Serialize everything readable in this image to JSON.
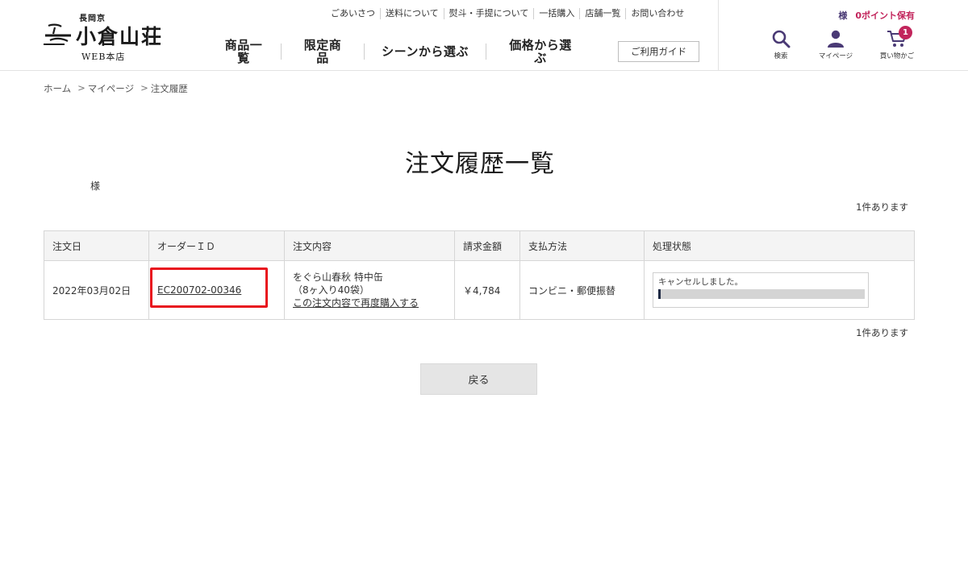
{
  "header": {
    "logo": {
      "sub": "長岡京",
      "main": "小倉山荘",
      "web": "WEB本店"
    },
    "top_nav": [
      "ごあいさつ",
      "送料について",
      "熨斗・手提について",
      "一括購入",
      "店舗一覧",
      "お問い合わせ"
    ],
    "main_nav": [
      "商品一覧",
      "限定商品",
      "シーンから選ぶ",
      "価格から選ぶ"
    ],
    "guide_label": "ご利用ガイド",
    "user_suffix": "様",
    "points_label": "0ポイント保有",
    "icons": {
      "search": {
        "label": "検索",
        "icon": "search-icon"
      },
      "mypage": {
        "label": "マイページ",
        "icon": "user-icon"
      },
      "cart": {
        "label": "買い物かご",
        "icon": "cart-icon",
        "badge": "1"
      }
    }
  },
  "breadcrumb": {
    "home": "ホーム",
    "mypage": "マイページ",
    "current": "注文履歴",
    "separator": ">"
  },
  "page": {
    "title": "注文履歴一覧",
    "user_name": "様",
    "count_text": "1件あります"
  },
  "table": {
    "headers": [
      "注文日",
      "オーダーＩＤ",
      "注文内容",
      "請求金額",
      "支払方法",
      "処理状態"
    ],
    "rows": [
      {
        "date": "2022年03月02日",
        "order_id": "EC200702-00346",
        "content_line1": "をぐら山春秋 特中缶",
        "content_line2": "（8ヶ入り40袋）",
        "rebuy_link": "この注文内容で再度購入する",
        "amount": "￥4,784",
        "payment": "コンビニ・郵便振替",
        "status": "キャンセルしました。",
        "status_progress": 0.01
      }
    ]
  },
  "back_label": "戻る",
  "colors": {
    "accent_pink": "#c2255c",
    "brand_purple": "#4a3a75",
    "highlight_red": "#e8141e"
  }
}
